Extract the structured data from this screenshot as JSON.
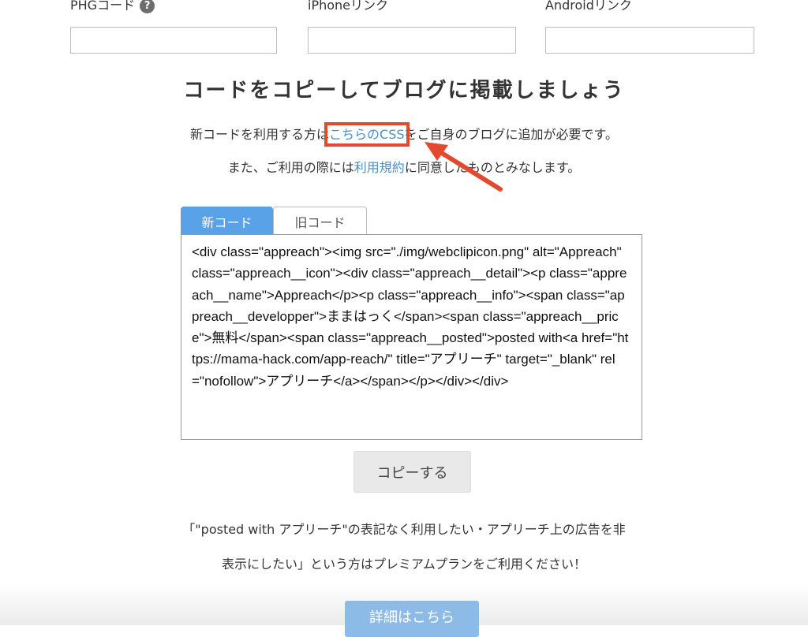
{
  "fields": [
    {
      "label": "PHGコード",
      "help_icon": "?",
      "value": ""
    },
    {
      "label": "iPhoneリンク",
      "value": ""
    },
    {
      "label": "Androidリンク",
      "value": ""
    }
  ],
  "heading": "コードをコピーしてブログに掲載しましょう",
  "notice1": {
    "before": "新コードを利用する方は",
    "link": "こちらのCSS",
    "after": "をご自身のブログに追加が必要です。"
  },
  "notice2": {
    "before": "また、ご利用の際には",
    "link": "利用規約",
    "after": "に同意したものとみなします。"
  },
  "annotation": {
    "color": "#e24a30"
  },
  "tabs": [
    {
      "label": "新コード",
      "active": true
    },
    {
      "label": "旧コード",
      "active": false
    }
  ],
  "code": "<div class=\"appreach\"><img src=\"./img/webclipicon.png\" alt=\"Appreach\" class=\"appreach__icon\"><div class=\"appreach__detail\"><p class=\"appreach__name\">Appreach</p><p class=\"appreach__info\"><span class=\"appreach__developper\">ままはっく</span><span class=\"appreach__price\">無料</span><span class=\"appreach__posted\">posted with<a href=\"https://mama-hack.com/app-reach/\" title=\"アプリーチ\" target=\"_blank\" rel=\"nofollow\">アプリーチ</a></span></p></div></div>",
  "copy_button": "コピーする",
  "premium": {
    "line1": "「\"posted with アプリーチ\"の表記なく利用したい・アプリーチ上の広告を非",
    "line2": "表示にしたい」という方はプレミアムプランをご利用ください！"
  },
  "details_button": "詳細はこちら",
  "colors": {
    "link": "#4a90c8",
    "active_tab": "#5aa2e8",
    "details_button": "#8cbbe8",
    "annotation": "#e24a30"
  }
}
